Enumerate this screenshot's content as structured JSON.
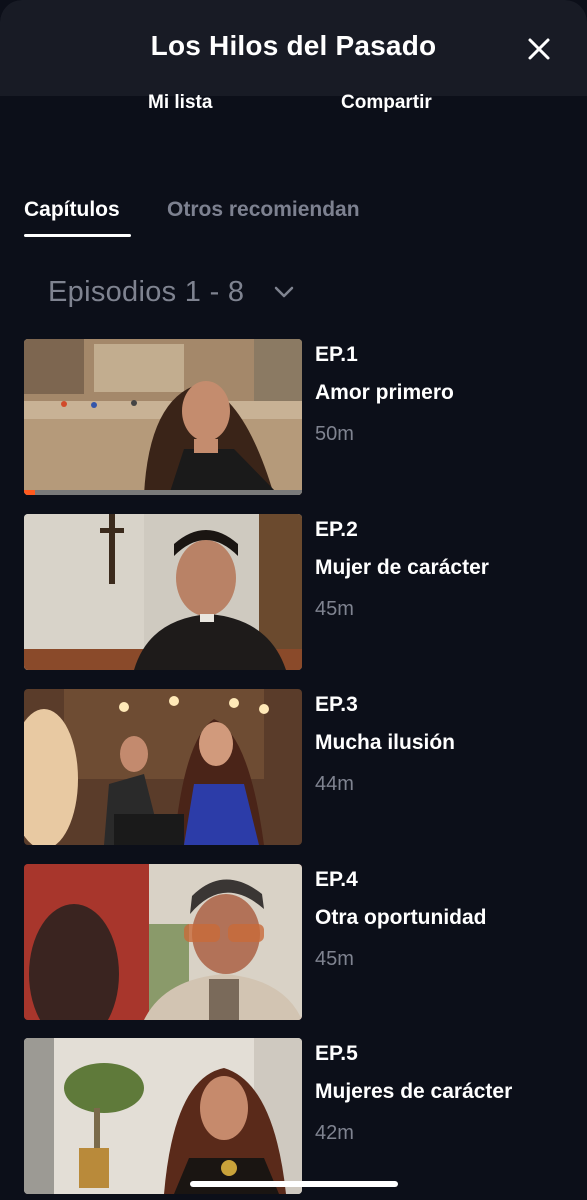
{
  "header": {
    "title": "Los Hilos del Pasado"
  },
  "actions": {
    "my_list": "Mi lista",
    "share": "Compartir"
  },
  "tabs": [
    {
      "label": "Capítulos",
      "active": true
    },
    {
      "label": "Otros recomiendan",
      "active": false
    }
  ],
  "season_select": {
    "label": "Episodios 1 - 8"
  },
  "episodes": [
    {
      "number": "EP.1",
      "title": "Amor primero",
      "duration": "50m",
      "progress": 0.04
    },
    {
      "number": "EP.2",
      "title": "Mujer de carácter",
      "duration": "45m"
    },
    {
      "number": "EP.3",
      "title": "Mucha ilusión",
      "duration": "44m"
    },
    {
      "number": "EP.4",
      "title": "Otra oportunidad",
      "duration": "45m"
    },
    {
      "number": "EP.5",
      "title": "Mujeres de carácter",
      "duration": "42m"
    }
  ],
  "colors": {
    "background": "#0c0f19",
    "header": "#181b25",
    "progress": "#ff5a1f",
    "muted_text": "#7f8390"
  }
}
